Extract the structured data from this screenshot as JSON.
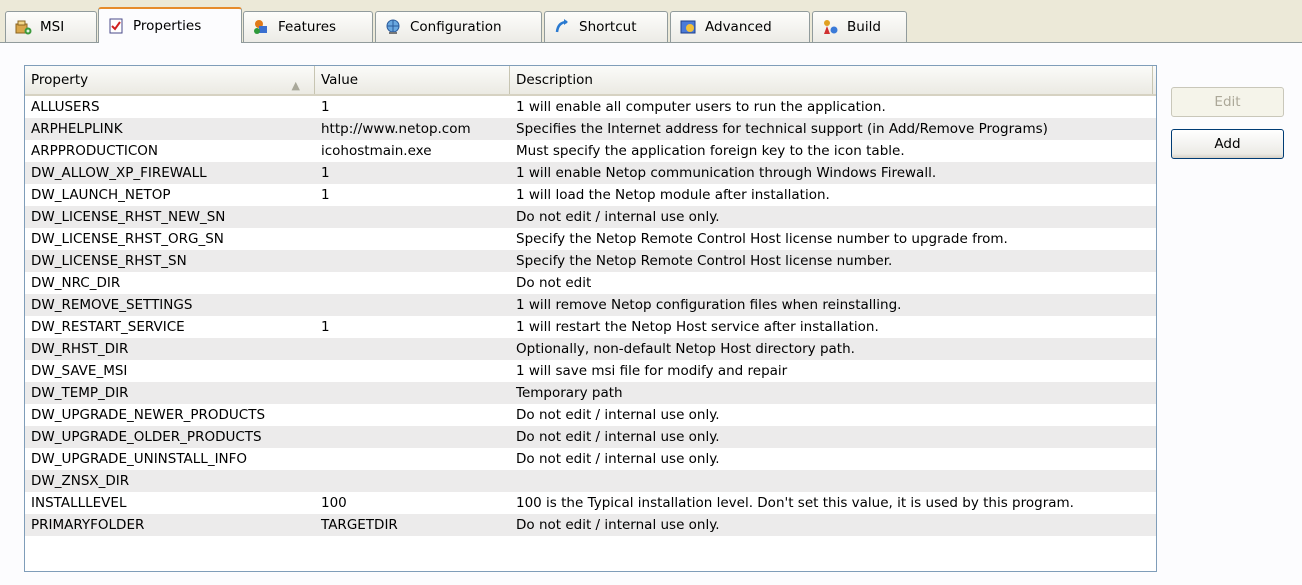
{
  "tabs": [
    {
      "label": "MSI",
      "icon": "msi-package-icon"
    },
    {
      "label": "Properties",
      "icon": "properties-checklist-icon"
    },
    {
      "label": "Features",
      "icon": "features-icon"
    },
    {
      "label": "Configuration",
      "icon": "configuration-globe-icon"
    },
    {
      "label": "Shortcut",
      "icon": "shortcut-icon"
    },
    {
      "label": "Advanced",
      "icon": "advanced-icon"
    },
    {
      "label": "Build",
      "icon": "build-icon"
    }
  ],
  "active_tab": "Properties",
  "grid": {
    "columns": [
      "Property",
      "Value",
      "Description"
    ],
    "rows": [
      {
        "property": "ALLUSERS",
        "value": "1",
        "description": "1 will enable all computer users to run the application."
      },
      {
        "property": "ARPHELPLINK",
        "value": "http://www.netop.com",
        "description": "Specifies the Internet address for technical support (in Add/Remove Programs)"
      },
      {
        "property": "ARPPRODUCTICON",
        "value": "icohostmain.exe",
        "description": "Must specify the application foreign key to the icon table."
      },
      {
        "property": "DW_ALLOW_XP_FIREWALL",
        "value": "1",
        "description": "1 will enable Netop communication through Windows Firewall."
      },
      {
        "property": "DW_LAUNCH_NETOP",
        "value": "1",
        "description": "1 will load the Netop module after installation."
      },
      {
        "property": "DW_LICENSE_RHST_NEW_SN",
        "value": "",
        "description": "Do not edit / internal use only."
      },
      {
        "property": "DW_LICENSE_RHST_ORG_SN",
        "value": "",
        "description": "Specify the Netop Remote Control Host license number to upgrade from."
      },
      {
        "property": "DW_LICENSE_RHST_SN",
        "value": "",
        "description": "Specify the Netop Remote Control Host license number."
      },
      {
        "property": "DW_NRC_DIR",
        "value": "",
        "description": "Do not edit"
      },
      {
        "property": "DW_REMOVE_SETTINGS",
        "value": "",
        "description": "1 will remove Netop configuration files when reinstalling."
      },
      {
        "property": "DW_RESTART_SERVICE",
        "value": "1",
        "description": "1 will restart the Netop Host service after installation."
      },
      {
        "property": "DW_RHST_DIR",
        "value": "",
        "description": "Optionally, non-default Netop Host directory path."
      },
      {
        "property": "DW_SAVE_MSI",
        "value": "",
        "description": "1 will save msi file for modify and repair"
      },
      {
        "property": "DW_TEMP_DIR",
        "value": "",
        "description": "Temporary path"
      },
      {
        "property": "DW_UPGRADE_NEWER_PRODUCTS",
        "value": "",
        "description": "Do not edit / internal use only."
      },
      {
        "property": "DW_UPGRADE_OLDER_PRODUCTS",
        "value": "",
        "description": "Do not edit / internal use only."
      },
      {
        "property": "DW_UPGRADE_UNINSTALL_INFO",
        "value": "",
        "description": "Do not edit / internal use only."
      },
      {
        "property": "DW_ZNSX_DIR",
        "value": "",
        "description": ""
      },
      {
        "property": "INSTALLLEVEL",
        "value": "100",
        "description": "100 is the Typical installation level. Don't set this value, it is used by this program."
      },
      {
        "property": "PRIMARYFOLDER",
        "value": "TARGETDIR",
        "description": "Do not edit / internal use only."
      }
    ]
  },
  "buttons": {
    "edit": "Edit",
    "add": "Add"
  },
  "colors": {
    "active_tab_accent": "#e68b2c",
    "alt_row": "#ecebeb",
    "window_bg": "#ece9d8"
  }
}
